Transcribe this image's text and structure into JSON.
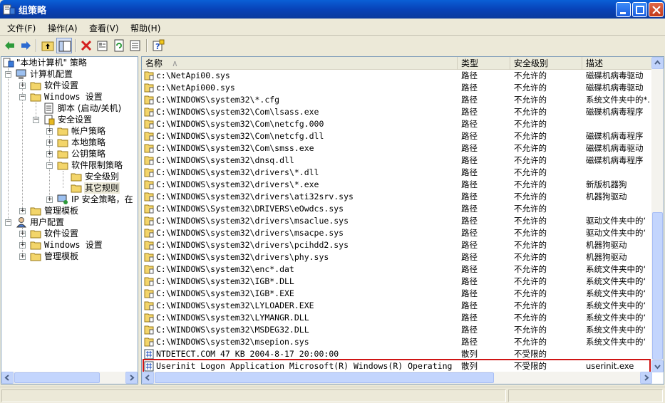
{
  "window": {
    "title": "组策略"
  },
  "menu": {
    "items": [
      "文件(F)",
      "操作(A)",
      "查看(V)",
      "帮助(H)"
    ]
  },
  "tree": {
    "root": "\"本地计算机\" 策略",
    "computer": "计算机配置",
    "software": "软件设置",
    "windows": "Windows 设置",
    "scripts": "脚本 (启动/关机)",
    "security": "安全设置",
    "account": "帐户策略",
    "local": "本地策略",
    "pubkey": "公钥策略",
    "srp": "软件限制策略",
    "levels": "安全级别",
    "other": "其它规则",
    "ipsec": "IP 安全策略，在",
    "admin": "管理模板",
    "user": "用户配置",
    "u_software": "软件设置",
    "u_windows": "Windows 设置",
    "u_admin": "管理模板"
  },
  "list": {
    "headers": {
      "name": "名称",
      "type": "类型",
      "level": "安全级别",
      "desc": "描述"
    },
    "rows": [
      {
        "name": "c:\\NetApi00.sys",
        "type": "路径",
        "level": "不允许的",
        "desc": "磁碟机病毒驱动"
      },
      {
        "name": "c:\\NetApi000.sys",
        "type": "路径",
        "level": "不允许的",
        "desc": "磁碟机病毒驱动"
      },
      {
        "name": "C:\\WINDOWS\\system32\\*.cfg",
        "type": "路径",
        "level": "不允许的",
        "desc": "系统文件夹中的*."
      },
      {
        "name": "C:\\WINDOWS\\system32\\Com\\lsass.exe",
        "type": "路径",
        "level": "不允许的",
        "desc": "磁碟机病毒程序"
      },
      {
        "name": "C:\\WINDOWS\\system32\\Com\\netcfg.000",
        "type": "路径",
        "level": "不允许的",
        "desc": ""
      },
      {
        "name": "C:\\WINDOWS\\system32\\Com\\netcfg.dll",
        "type": "路径",
        "level": "不允许的",
        "desc": "磁碟机病毒程序"
      },
      {
        "name": "C:\\WINDOWS\\system32\\Com\\smss.exe",
        "type": "路径",
        "level": "不允许的",
        "desc": "磁碟机病毒驱动"
      },
      {
        "name": "C:\\WINDOWS\\system32\\dnsq.dll",
        "type": "路径",
        "level": "不允许的",
        "desc": "磁碟机病毒程序"
      },
      {
        "name": "C:\\WINDOWS\\system32\\drivers\\*.dll",
        "type": "路径",
        "level": "不允许的",
        "desc": ""
      },
      {
        "name": "C:\\WINDOWS\\system32\\drivers\\*.exe",
        "type": "路径",
        "level": "不允许的",
        "desc": "新版机器狗"
      },
      {
        "name": "C:\\WINDOWS\\system32\\drivers\\ati32srv.sys",
        "type": "路径",
        "level": "不允许的",
        "desc": "机器狗驱动"
      },
      {
        "name": "C:\\WINDOWS\\System32\\DRIVERS\\eOwdcs.sys",
        "type": "路径",
        "level": "不允许的",
        "desc": ""
      },
      {
        "name": "C:\\WINDOWS\\system32\\drivers\\msaclue.sys",
        "type": "路径",
        "level": "不允许的",
        "desc": "驱动文件夹中的‘"
      },
      {
        "name": "C:\\WINDOWS\\system32\\drivers\\msacpe.sys",
        "type": "路径",
        "level": "不允许的",
        "desc": "驱动文件夹中的‘"
      },
      {
        "name": "C:\\WINDOWS\\system32\\drivers\\pcihdd2.sys",
        "type": "路径",
        "level": "不允许的",
        "desc": "机器狗驱动"
      },
      {
        "name": "C:\\WINDOWS\\system32\\drivers\\phy.sys",
        "type": "路径",
        "level": "不允许的",
        "desc": "机器狗驱动"
      },
      {
        "name": "C:\\WINDOWS\\system32\\enc*.dat",
        "type": "路径",
        "level": "不允许的",
        "desc": "系统文件夹中的‘"
      },
      {
        "name": "C:\\WINDOWS\\system32\\IGB*.DLL",
        "type": "路径",
        "level": "不允许的",
        "desc": "系统文件夹中的‘"
      },
      {
        "name": "C:\\WINDOWS\\system32\\IGB*.EXE",
        "type": "路径",
        "level": "不允许的",
        "desc": "系统文件夹中的‘"
      },
      {
        "name": "C:\\WINDOWS\\system32\\LYLOADER.EXE",
        "type": "路径",
        "level": "不允许的",
        "desc": "系统文件夹中的‘"
      },
      {
        "name": "C:\\WINDOWS\\system32\\LYMANGR.DLL",
        "type": "路径",
        "level": "不允许的",
        "desc": "系统文件夹中的‘"
      },
      {
        "name": "C:\\WINDOWS\\system32\\MSDEG32.DLL",
        "type": "路径",
        "level": "不允许的",
        "desc": "系统文件夹中的‘"
      },
      {
        "name": "C:\\WINDOWS\\system32\\msepion.sys",
        "type": "路径",
        "level": "不允许的",
        "desc": "系统文件夹中的‘"
      },
      {
        "name": "NTDETECT.COM  47  KB  2004-8-17  20:00:00",
        "type": "散列",
        "level": "不受限的",
        "desc": ""
      },
      {
        "name": "Userinit Logon Application  Microsoft(R) Windows(R) Operating Syste...",
        "type": "散列",
        "level": "不受限的",
        "desc": "userinit.exe"
      }
    ]
  }
}
